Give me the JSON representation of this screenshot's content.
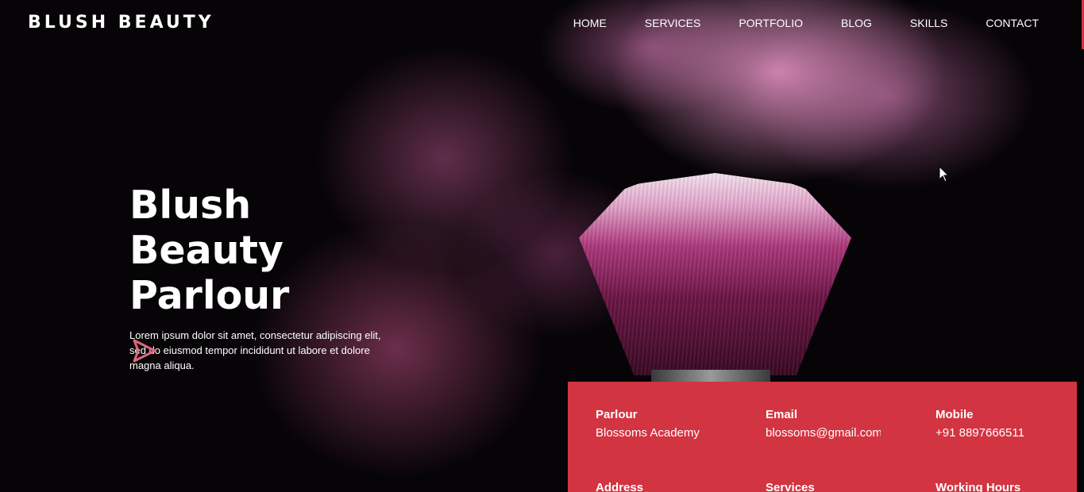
{
  "brand": {
    "name": "BLUSH BEAUTY"
  },
  "nav": {
    "items": [
      {
        "label": "HOME"
      },
      {
        "label": "SERVICES"
      },
      {
        "label": "PORTFOLIO"
      },
      {
        "label": "BLOG"
      },
      {
        "label": "SKILLS"
      },
      {
        "label": "CONTACT"
      }
    ]
  },
  "hero": {
    "title_line1": "Blush Beauty",
    "title_line2": "Parlour",
    "description": "Lorem ipsum dolor sit amet, consectetur adipiscing elit, sed do eiusmod tempor incididunt ut labore et dolore magna aliqua.",
    "play_icon": "play-triangle-icon"
  },
  "info": {
    "items": [
      {
        "label": "Parlour",
        "value": "Blossoms Academy"
      },
      {
        "label": "Email",
        "value": "blossoms@gmail.com"
      },
      {
        "label": "Mobile",
        "value": "+91 8897666511"
      },
      {
        "label": "Address",
        "value": ""
      },
      {
        "label": "Services",
        "value": ""
      },
      {
        "label": "Working Hours",
        "value": ""
      }
    ]
  },
  "colors": {
    "accent": "#d23442",
    "play_icon": "#e0657f",
    "background": "#070407"
  }
}
